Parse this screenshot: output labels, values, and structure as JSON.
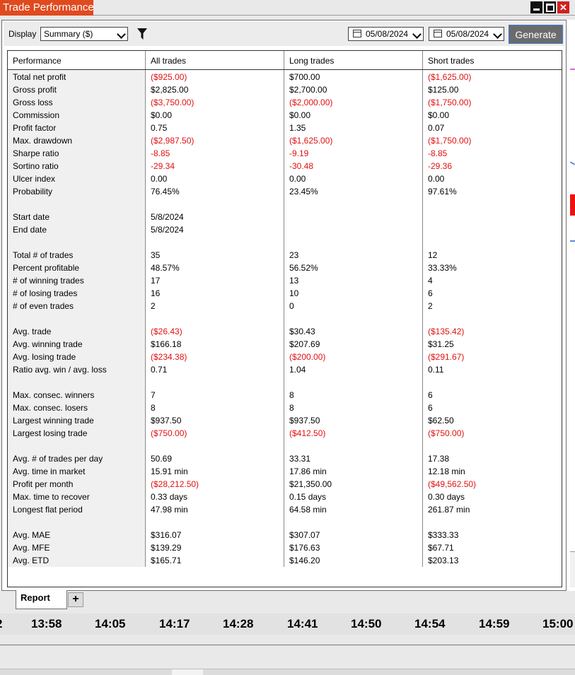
{
  "window": {
    "title": "Trade Performance"
  },
  "toolbar": {
    "display_label": "Display",
    "display_value": "Summary ($)",
    "date_from": "05/08/2024",
    "date_to": "05/08/2024",
    "generate_label": "Generate"
  },
  "table": {
    "headers": [
      "Performance",
      "All trades",
      "Long trades",
      "Short trades"
    ],
    "rows": [
      {
        "label": "Total net profit",
        "all": "($925.00)",
        "long": "$700.00",
        "short": "($1,625.00)"
      },
      {
        "label": "Gross profit",
        "all": "$2,825.00",
        "long": "$2,700.00",
        "short": "$125.00"
      },
      {
        "label": "Gross loss",
        "all": "($3,750.00)",
        "long": "($2,000.00)",
        "short": "($1,750.00)"
      },
      {
        "label": "Commission",
        "all": "$0.00",
        "long": "$0.00",
        "short": "$0.00"
      },
      {
        "label": "Profit factor",
        "all": "0.75",
        "long": "1.35",
        "short": "0.07"
      },
      {
        "label": "Max. drawdown",
        "all": "($2,987.50)",
        "long": "($1,625.00)",
        "short": "($1,750.00)"
      },
      {
        "label": "Sharpe ratio",
        "all": "-8.85",
        "long": "-9.19",
        "short": "-8.85"
      },
      {
        "label": "Sortino ratio",
        "all": "-29.34",
        "long": "-30.48",
        "short": "-29.36"
      },
      {
        "label": "Ulcer index",
        "all": "0.00",
        "long": "0.00",
        "short": "0.00"
      },
      {
        "label": "Probability",
        "all": "76.45%",
        "long": "23.45%",
        "short": "97.61%"
      },
      {
        "label": "",
        "all": "",
        "long": "",
        "short": ""
      },
      {
        "label": "Start date",
        "all": "5/8/2024",
        "long": "",
        "short": ""
      },
      {
        "label": "End date",
        "all": "5/8/2024",
        "long": "",
        "short": ""
      },
      {
        "label": "",
        "all": "",
        "long": "",
        "short": ""
      },
      {
        "label": "Total # of trades",
        "all": "35",
        "long": "23",
        "short": "12"
      },
      {
        "label": "Percent profitable",
        "all": "48.57%",
        "long": "56.52%",
        "short": "33.33%"
      },
      {
        "label": "# of winning trades",
        "all": "17",
        "long": "13",
        "short": "4"
      },
      {
        "label": "# of losing trades",
        "all": "16",
        "long": "10",
        "short": "6"
      },
      {
        "label": "# of even trades",
        "all": "2",
        "long": "0",
        "short": "2"
      },
      {
        "label": "",
        "all": "",
        "long": "",
        "short": ""
      },
      {
        "label": "Avg. trade",
        "all": "($26.43)",
        "long": "$30.43",
        "short": "($135.42)"
      },
      {
        "label": "Avg. winning trade",
        "all": "$166.18",
        "long": "$207.69",
        "short": "$31.25"
      },
      {
        "label": "Avg. losing trade",
        "all": "($234.38)",
        "long": "($200.00)",
        "short": "($291.67)"
      },
      {
        "label": "Ratio avg. win / avg. loss",
        "all": "0.71",
        "long": "1.04",
        "short": "0.11"
      },
      {
        "label": "",
        "all": "",
        "long": "",
        "short": ""
      },
      {
        "label": "Max. consec. winners",
        "all": "7",
        "long": "8",
        "short": "6"
      },
      {
        "label": "Max. consec. losers",
        "all": "8",
        "long": "8",
        "short": "6"
      },
      {
        "label": "Largest winning trade",
        "all": "$937.50",
        "long": "$937.50",
        "short": "$62.50"
      },
      {
        "label": "Largest losing trade",
        "all": "($750.00)",
        "long": "($412.50)",
        "short": "($750.00)"
      },
      {
        "label": "",
        "all": "",
        "long": "",
        "short": ""
      },
      {
        "label": "Avg. # of trades per day",
        "all": "50.69",
        "long": "33.31",
        "short": "17.38"
      },
      {
        "label": "Avg. time in market",
        "all": "15.91 min",
        "long": "17.86 min",
        "short": "12.18 min"
      },
      {
        "label": "Profit per month",
        "all": "($28,212.50)",
        "long": "$21,350.00",
        "short": "($49,562.50)"
      },
      {
        "label": "Max. time to recover",
        "all": "0.33 days",
        "long": "0.15 days",
        "short": "0.30 days"
      },
      {
        "label": "Longest flat period",
        "all": "47.98 min",
        "long": "64.58 min",
        "short": "261.87 min"
      },
      {
        "label": "",
        "all": "",
        "long": "",
        "short": ""
      },
      {
        "label": "Avg. MAE",
        "all": "$316.07",
        "long": "$307.07",
        "short": "$333.33"
      },
      {
        "label": "Avg. MFE",
        "all": "$139.29",
        "long": "$176.63",
        "short": "$67.71"
      },
      {
        "label": "Avg. ETD",
        "all": "$165.71",
        "long": "$146.20",
        "short": "$203.13"
      }
    ]
  },
  "tabs": {
    "report": "Report",
    "add": "+"
  },
  "time_axis": [
    "2",
    "13:58",
    "14:05",
    "14:17",
    "14:28",
    "14:41",
    "14:50",
    "14:54",
    "14:59",
    "15:00"
  ],
  "colors": {
    "title_bg": "#e04a1f",
    "negative": "#e11010",
    "generate_bg": "#6b6b6b"
  }
}
